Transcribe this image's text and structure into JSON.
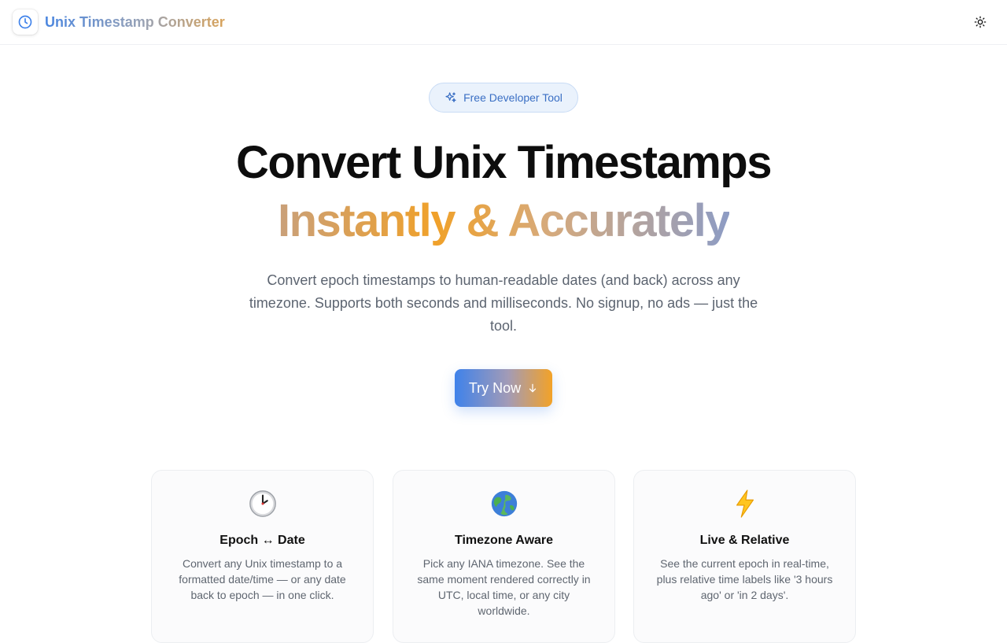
{
  "header": {
    "brand": "Unix Timestamp Converter",
    "logo_icon": "clock-icon",
    "theme_icon": "sun-icon"
  },
  "hero": {
    "badge": {
      "icon": "sparkles-icon",
      "label": "Free Developer Tool"
    },
    "title_line1": "Convert Unix Timestamps",
    "title_line2": "Instantly & Accurately",
    "subtitle": "Convert epoch timestamps to human-readable dates (and back) across any timezone. Supports both seconds and milliseconds. No signup, no ads — just the tool.",
    "cta": {
      "label": "Try Now",
      "icon": "arrow-down-icon"
    }
  },
  "features": [
    {
      "emoji": "🕐",
      "icon": "clock-emoji-icon",
      "title": "Epoch ↔ Date",
      "description": "Convert any Unix timestamp to a formatted date/time — or any date back to epoch — in one click."
    },
    {
      "emoji": "🌍",
      "icon": "globe-emoji-icon",
      "title": "Timezone Aware",
      "description": "Pick any IANA timezone. See the same moment rendered correctly in UTC, local time, or any city worldwide."
    },
    {
      "emoji": "⚡",
      "icon": "lightning-emoji-icon",
      "title": "Live & Relative",
      "description": "See the current epoch in real-time, plus relative time labels like '3 hours ago' or 'in 2 days'."
    }
  ],
  "colors": {
    "accent_blue": "#3f82ea",
    "accent_orange": "#f3a227",
    "badge_bg": "#eaf2fc",
    "badge_text": "#3a6fc4",
    "body_text": "#5c6470"
  }
}
